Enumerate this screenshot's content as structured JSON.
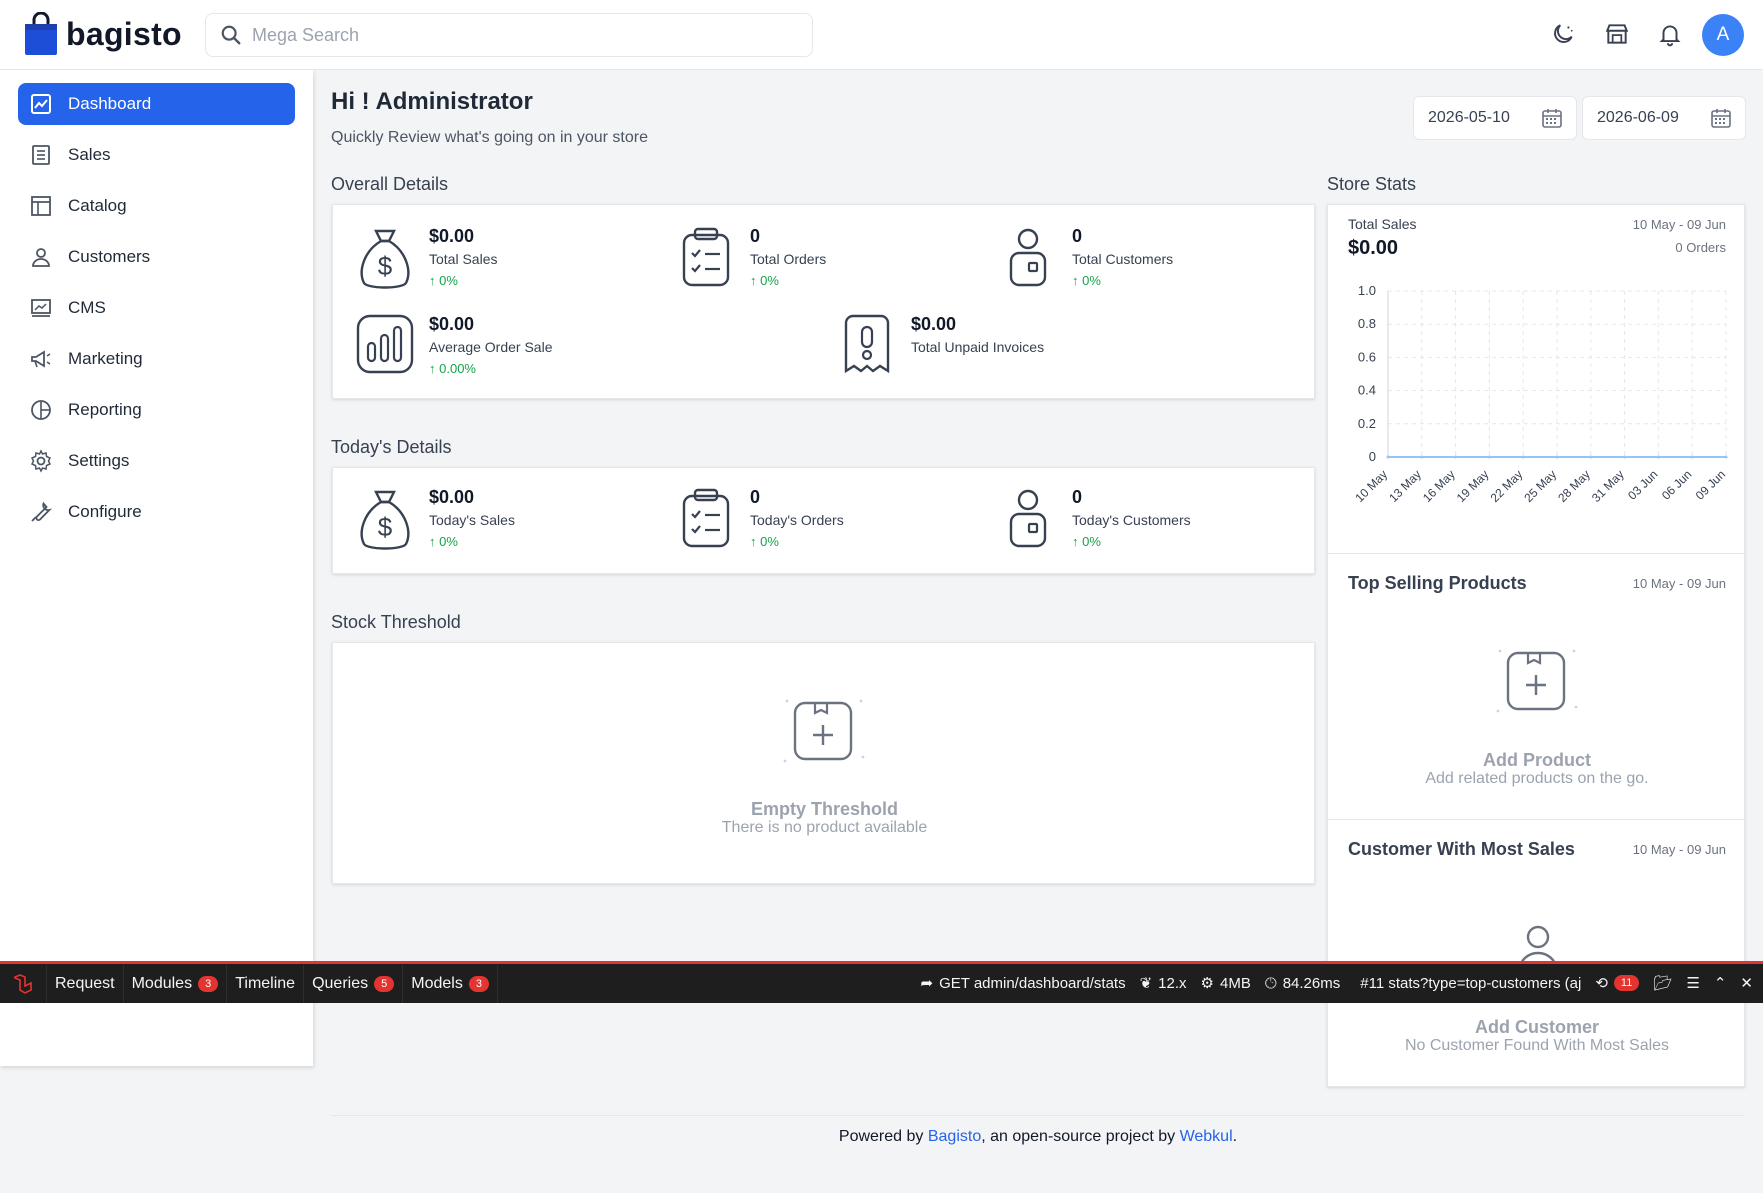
{
  "header": {
    "brand": "bagisto",
    "search_placeholder": "Mega Search",
    "avatar_initial": "A"
  },
  "sidebar": {
    "items": [
      {
        "label": "Dashboard",
        "icon": "dashboard-icon",
        "active": true
      },
      {
        "label": "Sales",
        "icon": "sales-icon"
      },
      {
        "label": "Catalog",
        "icon": "catalog-icon"
      },
      {
        "label": "Customers",
        "icon": "customers-icon"
      },
      {
        "label": "CMS",
        "icon": "cms-icon"
      },
      {
        "label": "Marketing",
        "icon": "marketing-icon"
      },
      {
        "label": "Reporting",
        "icon": "reporting-icon"
      },
      {
        "label": "Settings",
        "icon": "settings-icon"
      },
      {
        "label": "Configure",
        "icon": "configure-icon"
      }
    ]
  },
  "main": {
    "greeting": "Hi ! Administrator",
    "subtitle": "Quickly Review what's going on in your store",
    "date_start": "2026-05-10",
    "date_end": "2026-06-09",
    "overall_title": "Overall Details",
    "overall": {
      "total_sales": {
        "value": "$0.00",
        "label": "Total Sales",
        "change": "0%"
      },
      "total_orders": {
        "value": "0",
        "label": "Total Orders",
        "change": "0%"
      },
      "total_customers": {
        "value": "0",
        "label": "Total Customers",
        "change": "0%"
      },
      "avg_order": {
        "value": "$0.00",
        "label": "Average Order Sale",
        "change": "0.00%"
      },
      "unpaid": {
        "value": "$0.00",
        "label": "Total Unpaid Invoices"
      }
    },
    "today_title": "Today's Details",
    "today": {
      "sales": {
        "value": "$0.00",
        "label": "Today's Sales",
        "change": "0%"
      },
      "orders": {
        "value": "0",
        "label": "Today's Orders",
        "change": "0%"
      },
      "customers": {
        "value": "0",
        "label": "Today's Customers",
        "change": "0%"
      }
    },
    "stock_title": "Stock Threshold",
    "stock_empty_title": "Empty Threshold",
    "stock_empty_sub": "There is no product available"
  },
  "store_stats": {
    "title": "Store Stats",
    "total_sales_label": "Total Sales",
    "total_sales_value": "$0.00",
    "date_range": "10 May - 09 Jun",
    "orders": "0 Orders",
    "top_selling_title": "Top Selling Products",
    "top_selling_date": "10 May - 09 Jun",
    "add_product_title": "Add Product",
    "add_product_sub": "Add related products on the go.",
    "customer_title": "Customer With Most Sales",
    "customer_date": "10 May - 09 Jun",
    "add_customer_title": "Add Customer",
    "add_customer_sub": "No Customer Found With Most Sales"
  },
  "chart_data": {
    "type": "line",
    "categories": [
      "10 May",
      "13 May",
      "16 May",
      "19 May",
      "22 May",
      "25 May",
      "28 May",
      "31 May",
      "03 Jun",
      "06 Jun",
      "09 Jun"
    ],
    "series": [
      {
        "values": [
          0,
          0,
          0,
          0,
          0,
          0,
          0,
          0,
          0,
          0,
          0
        ]
      }
    ],
    "yticks": [
      "0",
      "0.2",
      "0.4",
      "0.6",
      "0.8",
      "1.0"
    ],
    "ylim": [
      0,
      1
    ],
    "grid": true
  },
  "debugbar": {
    "tabs": [
      {
        "label": "Request"
      },
      {
        "label": "Modules",
        "badge": "3"
      },
      {
        "label": "Timeline"
      },
      {
        "label": "Queries",
        "badge": "5"
      },
      {
        "label": "Models",
        "badge": "3"
      }
    ],
    "route": "GET admin/dashboard/stats",
    "version": "12.x",
    "memory": "4MB",
    "time": "84.26ms",
    "request": "#11 stats?type=top-customers (aj",
    "history_badge": "11"
  },
  "footer": {
    "prefix": "Powered by ",
    "link1": "Bagisto",
    "middle": ", an open-source project by ",
    "link2": "Webkul",
    "suffix": "."
  },
  "colors": {
    "primary": "#2563eb",
    "positive": "#16a34a",
    "debug_red": "#e3342f"
  }
}
